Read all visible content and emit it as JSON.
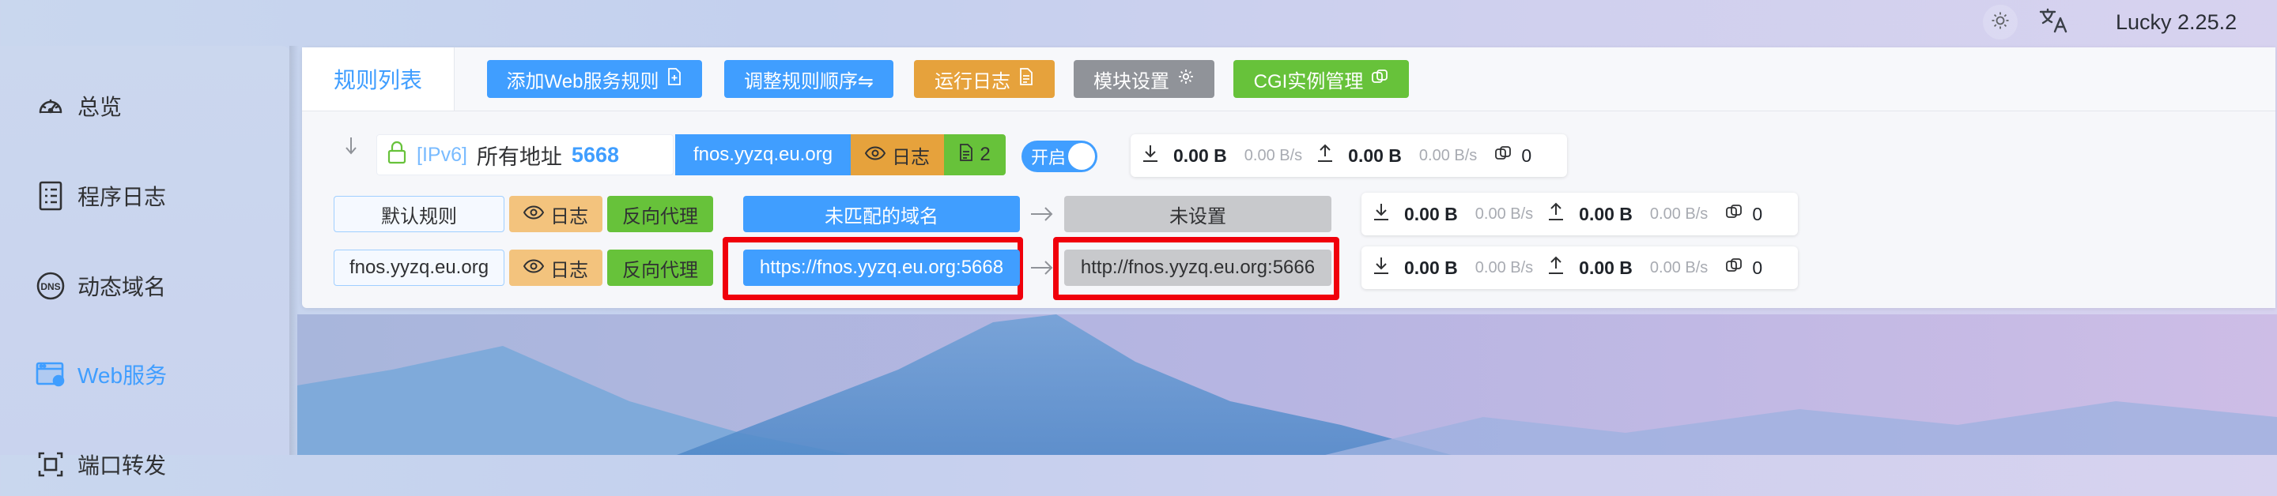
{
  "app": {
    "version": "Lucky 2.25.2"
  },
  "colors": {
    "primary": "#409eff",
    "warning": "#e6a23c",
    "success": "#67c23a",
    "info": "#909399",
    "highlight": "#f0000b"
  },
  "sidebar": {
    "items": [
      {
        "label": "总览",
        "icon": "dashboard-icon"
      },
      {
        "label": "程序日志",
        "icon": "log-file-icon"
      },
      {
        "label": "动态域名",
        "icon": "dns-icon"
      },
      {
        "label": "Web服务",
        "icon": "web-service-icon",
        "active": true
      },
      {
        "label": "端口转发",
        "icon": "port-forward-icon"
      }
    ]
  },
  "tabs": {
    "rule_list": "规则列表"
  },
  "toolbar": {
    "add_rule": "添加Web服务规则",
    "reorder": "调整规则顺序⇋",
    "run_log": "运行日志",
    "module_settings": "模块设置",
    "cgi_manage": "CGI实例管理"
  },
  "rule": {
    "ip_version": "[IPv6]",
    "address": "所有地址",
    "port": "5668",
    "domain": "fnos.yyzq.eu.org",
    "log_label": "日志",
    "sub_rule_count": "2",
    "switch_label": "开启",
    "traffic": {
      "down": "0.00 B",
      "down_rate": "0.00 B/s",
      "up": "0.00 B",
      "up_rate": "0.00 B/s",
      "conn": "0"
    }
  },
  "sub_rules": [
    {
      "name": "默认规则",
      "log_label": "日志",
      "type": "反向代理",
      "match": "未匹配的域名",
      "target": "未设置",
      "traffic": {
        "down": "0.00 B",
        "down_rate": "0.00 B/s",
        "up": "0.00 B",
        "up_rate": "0.00 B/s",
        "conn": "0"
      }
    },
    {
      "name": "fnos.yyzq.eu.org",
      "log_label": "日志",
      "type": "反向代理",
      "match": "https://fnos.yyzq.eu.org:5668",
      "target": "http://fnos.yyzq.eu.org:5666",
      "traffic": {
        "down": "0.00 B",
        "down_rate": "0.00 B/s",
        "up": "0.00 B",
        "up_rate": "0.00 B/s",
        "conn": "0"
      }
    }
  ]
}
